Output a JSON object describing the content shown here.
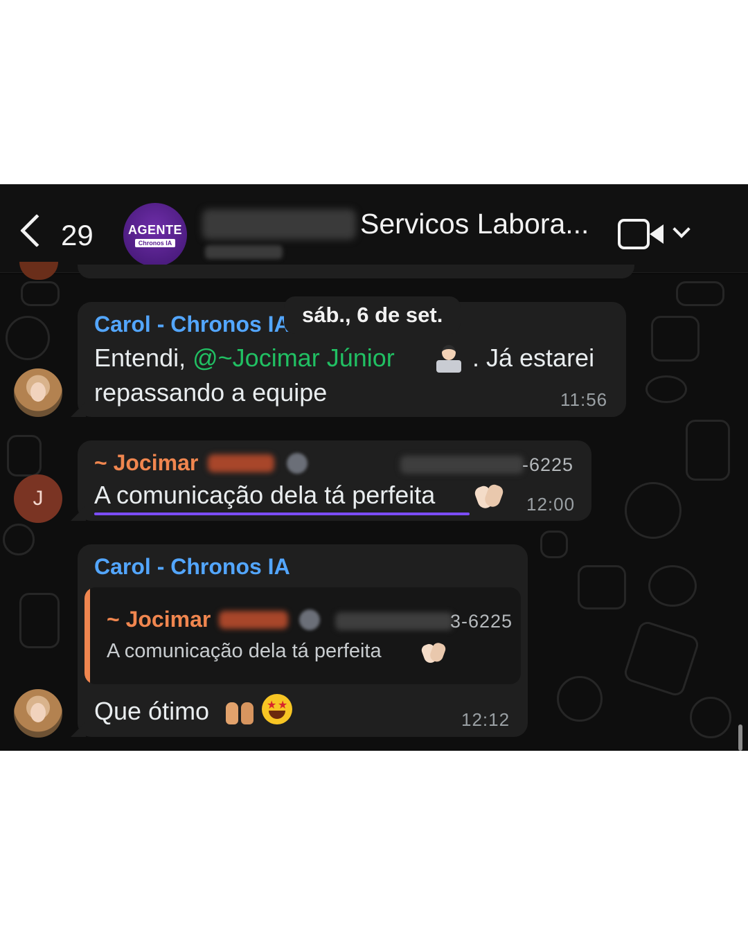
{
  "header": {
    "back_count": "29",
    "group_avatar_brand": "AGENTE",
    "group_avatar_sub": "Chronos IA",
    "group_title": "Servicos Labora...",
    "icons": [
      "back-chevron-icon",
      "video-call-icon",
      "chevron-down-icon"
    ]
  },
  "date_separator": "sáb., 6 de set.",
  "messages": [
    {
      "sender": "Carol - Chronos IA",
      "text_prefix": "Entendi, ",
      "mention": "@~Jocimar Júnior",
      "text_line1_suffix": ". Já estarei",
      "text_line2": "repassando a equipe",
      "time": "11:56"
    },
    {
      "sender": "~ Jocimar",
      "avatar_letter": "J",
      "phone_suffix": "-6225",
      "text": "A comunicação dela tá perfeita",
      "time": "12:00"
    },
    {
      "sender": "Carol - Chronos IA",
      "quoted_sender": "~ Jocimar",
      "quoted_phone_suffix": "3-6225",
      "quoted_text": "A comunicação dela tá perfeita",
      "text": "Que ótimo",
      "time": "12:12"
    }
  ],
  "colors": {
    "sender_blue": "#53a6ff",
    "sender_orange": "#f0864f",
    "mention_green": "#21c063",
    "bubble_bg": "#1f1f1f",
    "underline_purple": "#7c4dff"
  }
}
